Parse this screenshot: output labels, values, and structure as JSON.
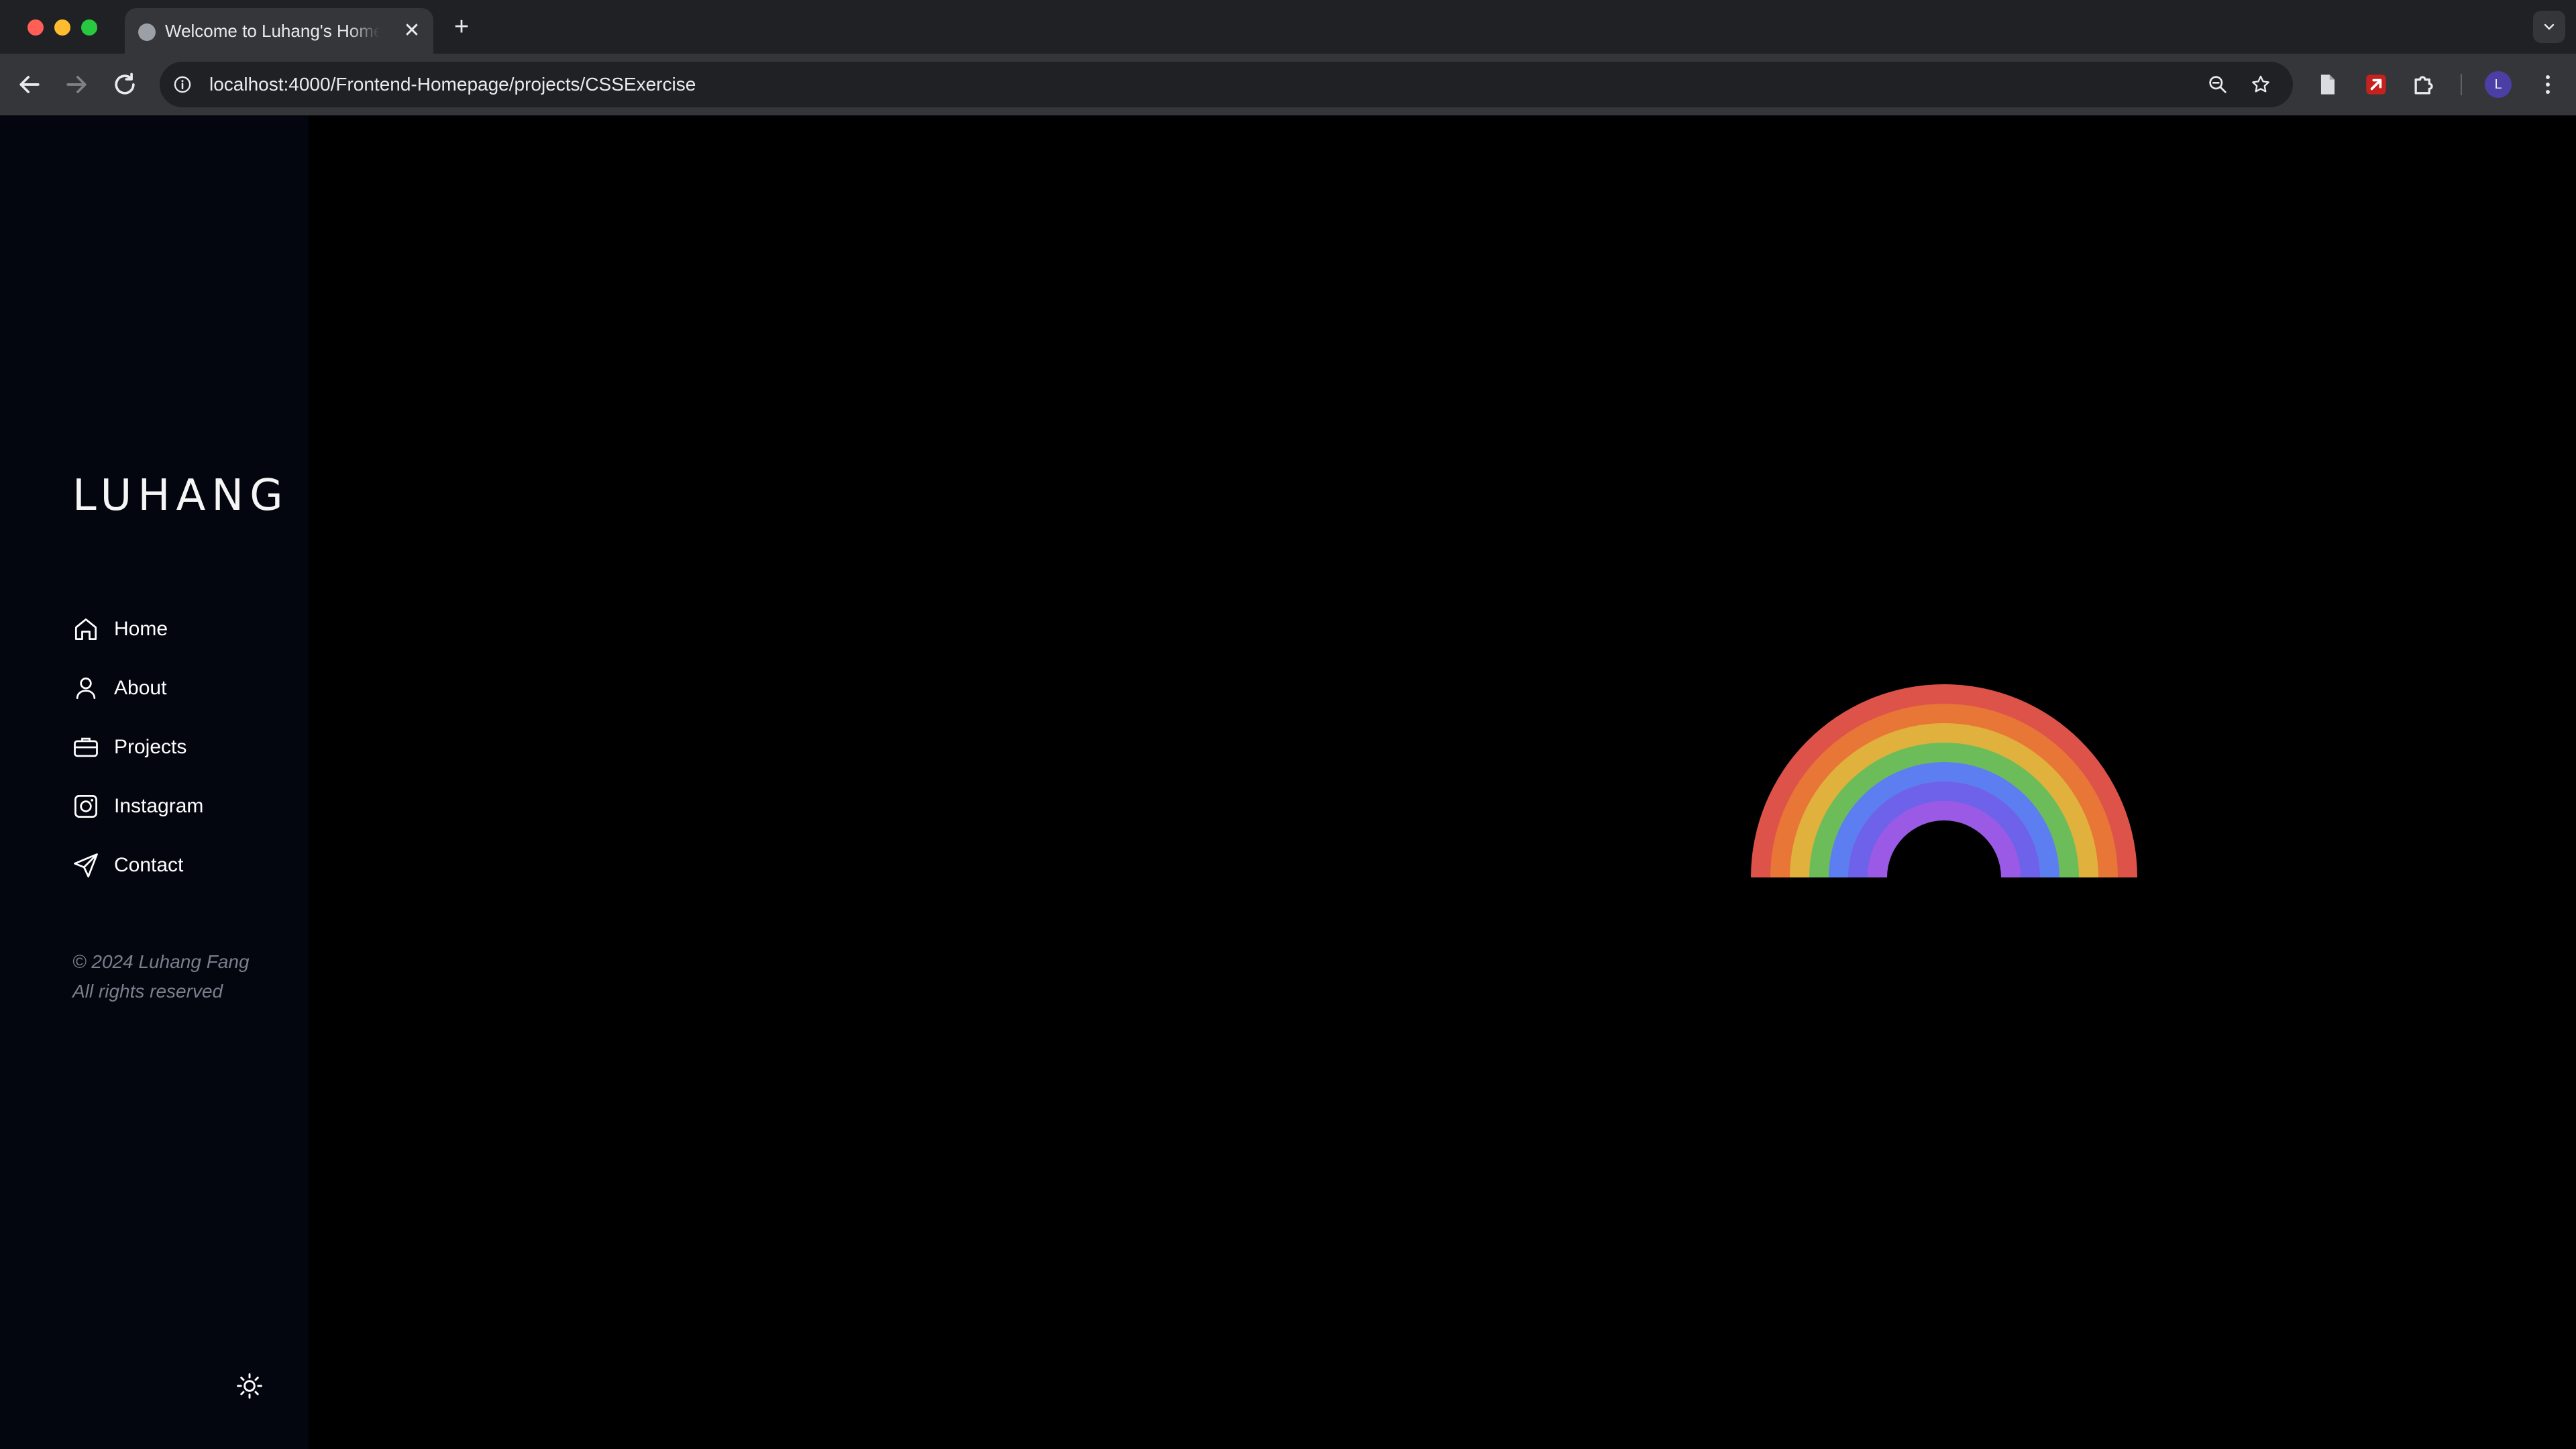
{
  "browser": {
    "tab_title": "Welcome to Luhang's Homepage",
    "tab_close": "✕",
    "new_tab": "+",
    "url": "localhost:4000/Frontend-Homepage/projects/CSSExercise",
    "profile_initial": "L"
  },
  "sidebar": {
    "brand": "LUHANG",
    "nav": [
      {
        "label": "Home",
        "icon": "home-icon"
      },
      {
        "label": "About",
        "icon": "user-icon"
      },
      {
        "label": "Projects",
        "icon": "briefcase-icon"
      },
      {
        "label": "Instagram",
        "icon": "instagram-icon"
      },
      {
        "label": "Contact",
        "icon": "send-icon"
      }
    ],
    "copyright_line1": "© 2024 Luhang Fang",
    "copyright_line2": "All rights reserved",
    "theme_toggle_icon": "sun-icon"
  },
  "main": {
    "rainbow_colors": [
      "#de5349",
      "#e87636",
      "#e0b13d",
      "#6cbd5a",
      "#5d7ef0",
      "#6f62ea",
      "#9b5ae6"
    ]
  }
}
